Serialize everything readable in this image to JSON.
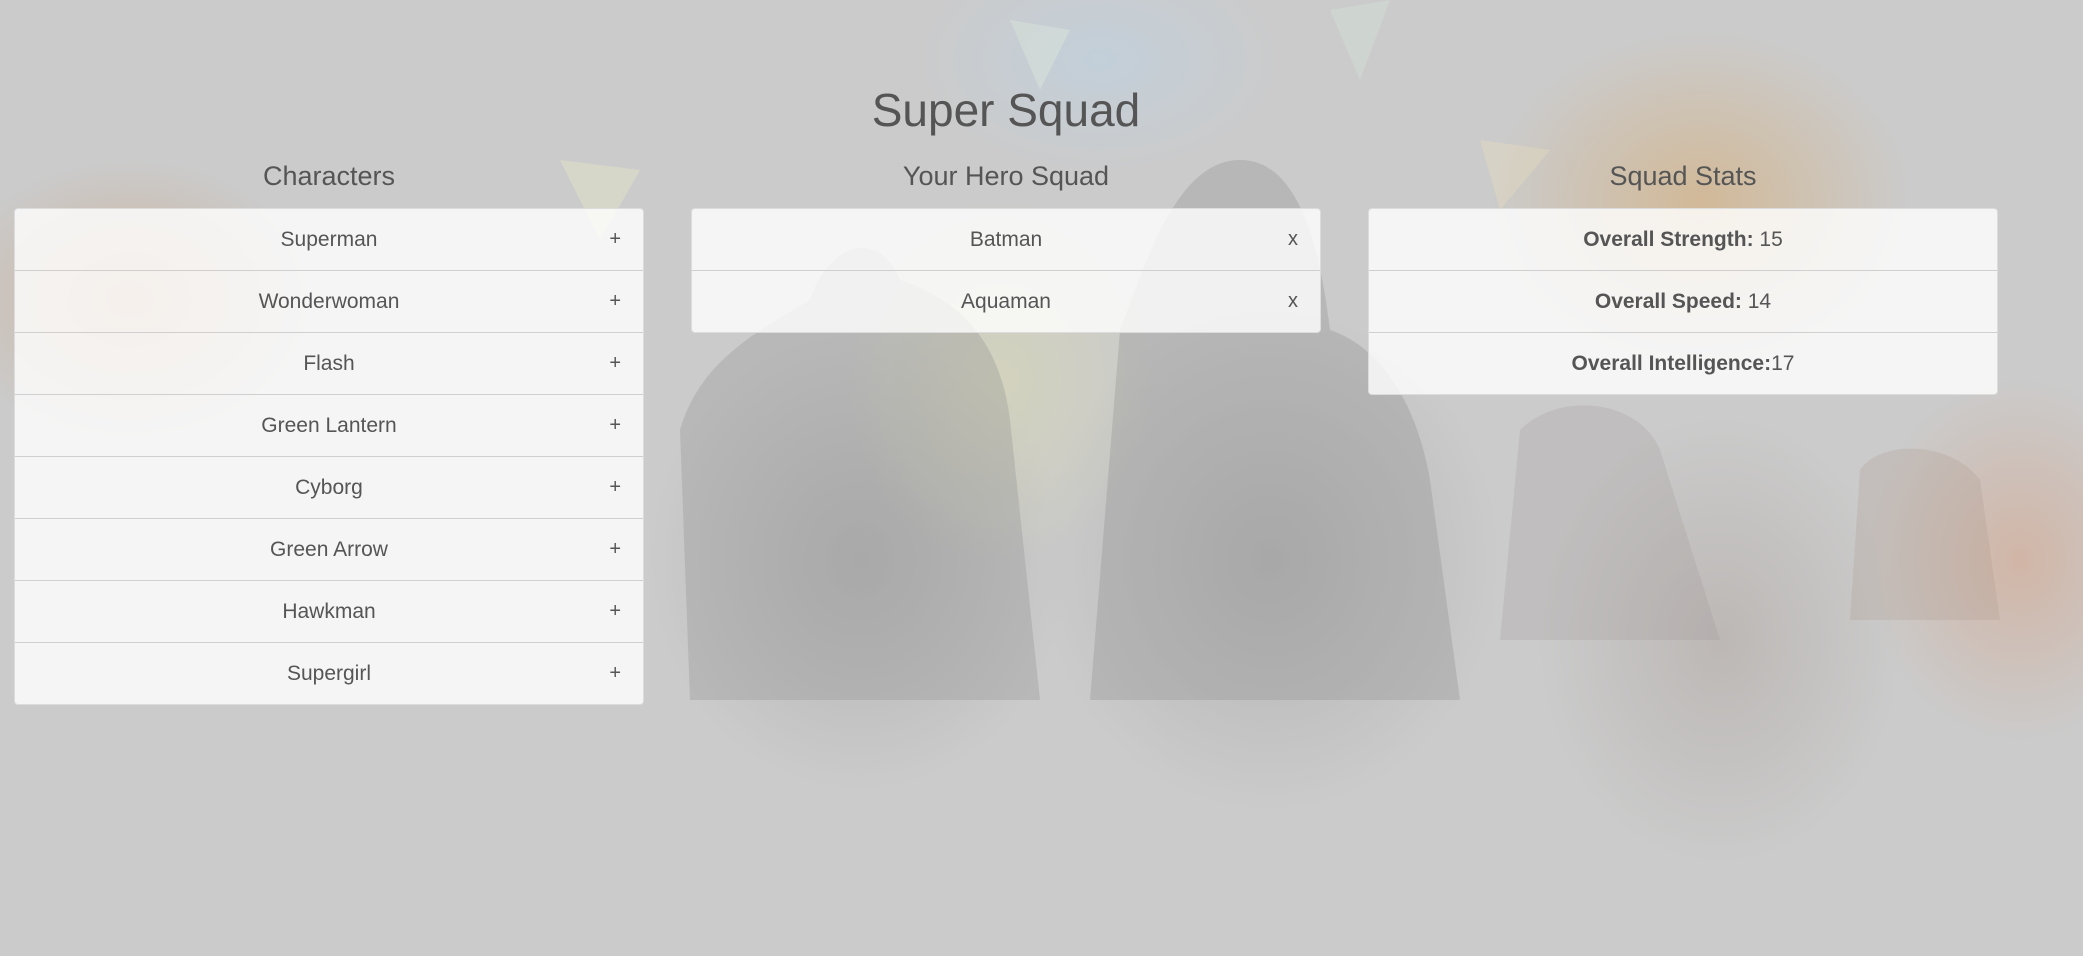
{
  "app": {
    "title": "Super Squad"
  },
  "characters": {
    "heading": "Characters",
    "add_symbol": "+",
    "items": [
      {
        "name": "Superman"
      },
      {
        "name": "Wonderwoman"
      },
      {
        "name": "Flash"
      },
      {
        "name": "Green Lantern"
      },
      {
        "name": "Cyborg"
      },
      {
        "name": "Green Arrow"
      },
      {
        "name": "Hawkman"
      },
      {
        "name": "Supergirl"
      }
    ]
  },
  "squad": {
    "heading": "Your Hero Squad",
    "remove_symbol": "x",
    "items": [
      {
        "name": "Batman"
      },
      {
        "name": "Aquaman"
      }
    ]
  },
  "stats": {
    "heading": "Squad Stats",
    "items": [
      {
        "label": "Overall Strength:",
        "value": " 15"
      },
      {
        "label": "Overall Speed:",
        "value": " 14"
      },
      {
        "label": "Overall Intelligence:",
        "value": "17"
      }
    ]
  },
  "colors": {
    "background": "#cbcbcb",
    "text": "#555555",
    "panel": "#f4f4f4"
  }
}
